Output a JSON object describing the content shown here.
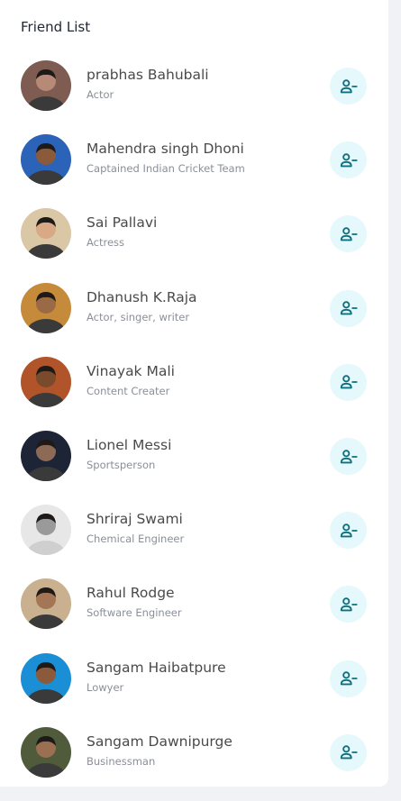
{
  "panel": {
    "title": "Friend List"
  },
  "colors": {
    "button_bg": "#e5f8fc",
    "icon": "#0e6f7e"
  },
  "friends": [
    {
      "name": "prabhas Bahubali",
      "role": "Actor",
      "avatar_tone": "#b68a76",
      "avatar_bg": "#7f5c52",
      "button_icon": "user-minus-icon"
    },
    {
      "name": "Mahendra singh Dhoni",
      "role": "Captained Indian Cricket Team",
      "avatar_tone": "#8a5a3a",
      "avatar_bg": "#2b63b8",
      "button_icon": "user-minus-icon"
    },
    {
      "name": "Sai Pallavi",
      "role": "Actress",
      "avatar_tone": "#d9a884",
      "avatar_bg": "#d9c7a6",
      "button_icon": "user-minus-icon"
    },
    {
      "name": "Dhanush K.Raja",
      "role": "Actor, singer, writer",
      "avatar_tone": "#9a6a44",
      "avatar_bg": "#c58b3a",
      "button_icon": "user-minus-icon"
    },
    {
      "name": "Vinayak Mali",
      "role": "Content Creater",
      "avatar_tone": "#7a4a2c",
      "avatar_bg": "#b2542a",
      "button_icon": "user-minus-icon"
    },
    {
      "name": "Lionel Messi",
      "role": "Sportsperson",
      "avatar_tone": "#8c6a56",
      "avatar_bg": "#1d2436",
      "button_icon": "user-minus-icon"
    },
    {
      "name": "Shriraj Swami",
      "role": "Chemical Engineer",
      "avatar_tone": "#9a9a9a",
      "avatar_bg": "#e7e7e7",
      "button_icon": "user-minus-icon"
    },
    {
      "name": "Rahul Rodge",
      "role": "Software Engineer",
      "avatar_tone": "#a47656",
      "avatar_bg": "#c9b08e",
      "button_icon": "user-minus-icon"
    },
    {
      "name": "Sangam Haibatpure",
      "role": "Lowyer",
      "avatar_tone": "#8a5a3a",
      "avatar_bg": "#1b8fd6",
      "button_icon": "user-minus-icon"
    },
    {
      "name": "Sangam Dawnipurge",
      "role": "Businessman",
      "avatar_tone": "#9a6f52",
      "avatar_bg": "#4f5b3a",
      "button_icon": "user-minus-icon"
    }
  ]
}
